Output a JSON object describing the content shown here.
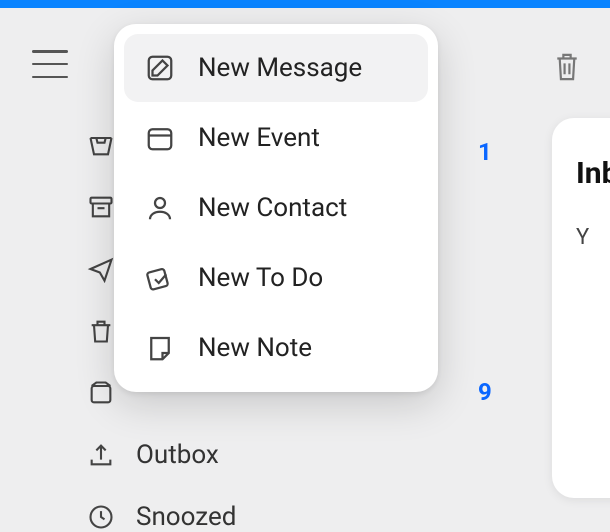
{
  "menu": {
    "items": [
      {
        "label": "New Message",
        "icon": "compose-icon",
        "selected": true
      },
      {
        "label": "New Event",
        "icon": "calendar-icon",
        "selected": false
      },
      {
        "label": "New Contact",
        "icon": "contact-icon",
        "selected": false
      },
      {
        "label": "New To Do",
        "icon": "todo-icon",
        "selected": false
      },
      {
        "label": "New Note",
        "icon": "note-icon",
        "selected": false
      }
    ]
  },
  "sidebar": {
    "items": [
      {
        "label": "",
        "icon": "inbox-icon"
      },
      {
        "label": "",
        "icon": "archive-icon"
      },
      {
        "label": "",
        "icon": "sent-icon"
      },
      {
        "label": "",
        "icon": "trash-icon"
      },
      {
        "label": "",
        "icon": "spam-icon"
      },
      {
        "label": "Outbox",
        "icon": "outbox-icon"
      },
      {
        "label": "Snoozed",
        "icon": "snoozed-icon"
      }
    ]
  },
  "badges": {
    "first": "1",
    "second": "9"
  },
  "main": {
    "title_fragment": "Inb",
    "sub_fragment": "Y"
  },
  "colors": {
    "accent": "#0a84ff",
    "badge": "#0a66ff"
  }
}
